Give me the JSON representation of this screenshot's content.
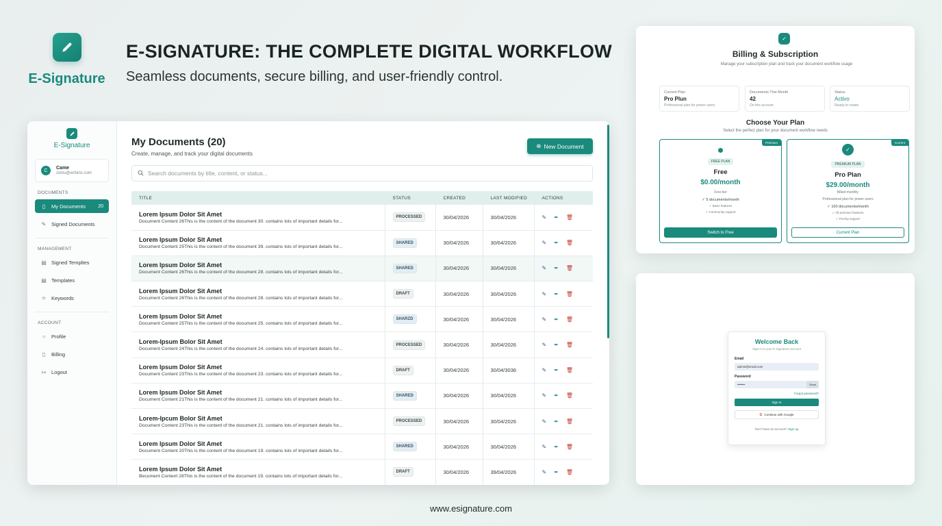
{
  "brand": {
    "name": "E-Signature",
    "icon": "pen-icon"
  },
  "header": {
    "title": "E-SIGNATURE: THE COMPLETE DIGITAL WORKFLOW",
    "subtitle": "Seamless documents, secure billing, and user-friendly control."
  },
  "sidebar": {
    "brand": "E-Signature",
    "user": {
      "initial": "C",
      "name": "Came",
      "email": "zomu@enfans.com"
    },
    "sections": {
      "documents": "DOCUMENTS",
      "management": "MANAGEMENT",
      "account": "ACCOUNT"
    },
    "items": [
      {
        "label": "My Documents",
        "count": "20",
        "icon": "document-icon"
      },
      {
        "label": "Signed Documents",
        "icon": "pen-icon"
      },
      {
        "label": "Signed Templtes",
        "icon": "template-icon"
      },
      {
        "label": "Templates",
        "icon": "template-icon"
      },
      {
        "label": "Keywords",
        "icon": "tag-icon"
      },
      {
        "label": "Profile",
        "icon": "user-icon"
      },
      {
        "label": "Billing",
        "icon": "billing-icon"
      },
      {
        "label": "Logout",
        "icon": "logout-icon"
      }
    ]
  },
  "documents": {
    "title": "My Documents (20)",
    "subtitle": "Create, manage, and track your digital documents",
    "new_button": "New Document",
    "search_placeholder": "Search documents by title, content, or status...",
    "columns": [
      "TITLE",
      "STATUS",
      "CREATED",
      "LAST MODIFIED",
      "ACTIONS"
    ],
    "rows": [
      {
        "title": "Lorem Ipsum Dolor Sit Amet",
        "desc": "Document Content 26This is the content of the document 30. contains lots of important details for...",
        "status": "PROCESSED",
        "created": "30/04/2026",
        "modified": "30/04/2026"
      },
      {
        "title": "Lorem Ipsum Dolor Sit Amet",
        "desc": "Document Content 25This is the content of the document 39. contains lots of important details for...",
        "status": "SHARED",
        "created": "30/04/2026",
        "modified": "30/64/2026"
      },
      {
        "title": "Lorem Ipsum Dolor Sit Amet",
        "desc": "Document Content 26This is the content of the document 28. contains lots of important details for...",
        "status": "SHARED",
        "created": "30/04/2026",
        "modified": "30/04/2026"
      },
      {
        "title": "Lorem Ipsum Dolor Sit Amet",
        "desc": "Document Content 26This is the content of the document 28. contains lots of important details for...",
        "status": "DRAFT",
        "created": "30/04/2026",
        "modified": "30/04/2026"
      },
      {
        "title": "Lorem Ipsum Dolor Sit Amet",
        "desc": "Document Content 25This is the content of the document 25. contains lots of important details for...",
        "status": "SHARZD",
        "created": "30/04/2026",
        "modified": "30/04/2026"
      },
      {
        "title": "Lorem-Ipsum Bolor Sit Amet",
        "desc": "Document Content 24This is the content of the document 24. contains lots of important details for...",
        "status": "PROCESSED",
        "created": "30/04/2026",
        "modified": "30/04/2026"
      },
      {
        "title": "Lorem Ipsum Dolor Sit Amet",
        "desc": "Document Content 23This is the content of the document 23. contains lots of important details for...",
        "status": "DRAFT",
        "created": "30/04/2026",
        "modified": "30/04/3036"
      },
      {
        "title": "Lorem Ipsum Dolor Sit Amet",
        "desc": "Document Content 21This is the content of the document 21. contains lots of important details for...",
        "status": "SHARED",
        "created": "30/04/2026",
        "modified": "30/04/2026"
      },
      {
        "title": "Lorem-Ipcum Bolor Sit Amet",
        "desc": "Document Content 23This is the content of the document 21. contains lots of important details for...",
        "status": "PROCESSED",
        "created": "30/04/2026",
        "modified": "30/04/2026"
      },
      {
        "title": "Lorem Ipsum Dolor Sit Amet",
        "desc": "Document Content 20This is the content of the document 19. contains lots of important details for...",
        "status": "SHARED",
        "created": "30/04/2026",
        "modified": "30/04/2026"
      },
      {
        "title": "Lorem Ipsum Dolor Sit Amet",
        "desc": "Becument Content 28This is the content of the document 19. contains lots of important details for...",
        "status": "DRAFT",
        "created": "30/04/2026",
        "modified": "39/04/2026"
      }
    ]
  },
  "billing": {
    "title": "Billing & Subscription",
    "subtitle": "Manage your subscription plan and track your document workflow usage",
    "stats": [
      {
        "label": "Current Plan",
        "value": "Pro Plun",
        "note": "Professional plan for power users"
      },
      {
        "label": "Documents This Month",
        "value": "42",
        "note": "On this account"
      },
      {
        "label": "Status",
        "value": "Activo",
        "note": "Ready to create"
      }
    ],
    "choose_title": "Choose Your Plan",
    "choose_subtitle": "Select the perfect plan for your document workflow needs",
    "plans": [
      {
        "corner": "Premium",
        "tag": "FREE PLAN",
        "name": "Free",
        "price": "$0.00/month",
        "desc": "Free tier",
        "features": [
          "5 documents/month",
          "Basic features",
          "Community support"
        ],
        "button": "Switch to Free"
      },
      {
        "corner": "Current",
        "tag": "PREMIUM PLAN",
        "name": "Pro Plan",
        "price": "$29.00/month",
        "desc": "Billed monthly",
        "desc2": "Professional plan for power users",
        "features": [
          "100 documents/month",
          "All premium features",
          "Priority support"
        ],
        "button": "Current Plan"
      }
    ]
  },
  "login": {
    "title": "Welcome Back",
    "subtitle": "Sign in to your E-Signature account",
    "email_label": "Email",
    "email_value": "admin@email.com",
    "password_label": "Password",
    "password_value": "•••••••",
    "show_label": "Show",
    "forgot": "Forgot password?",
    "signin": "Sign In",
    "google": "Continue with Google",
    "signup_text": "Don't have an account?",
    "signup_link": "Sign up"
  },
  "footer": {
    "url": "www.esignature.com"
  },
  "colors": {
    "accent": "#1a8a7c",
    "background": "#edf3f2"
  }
}
